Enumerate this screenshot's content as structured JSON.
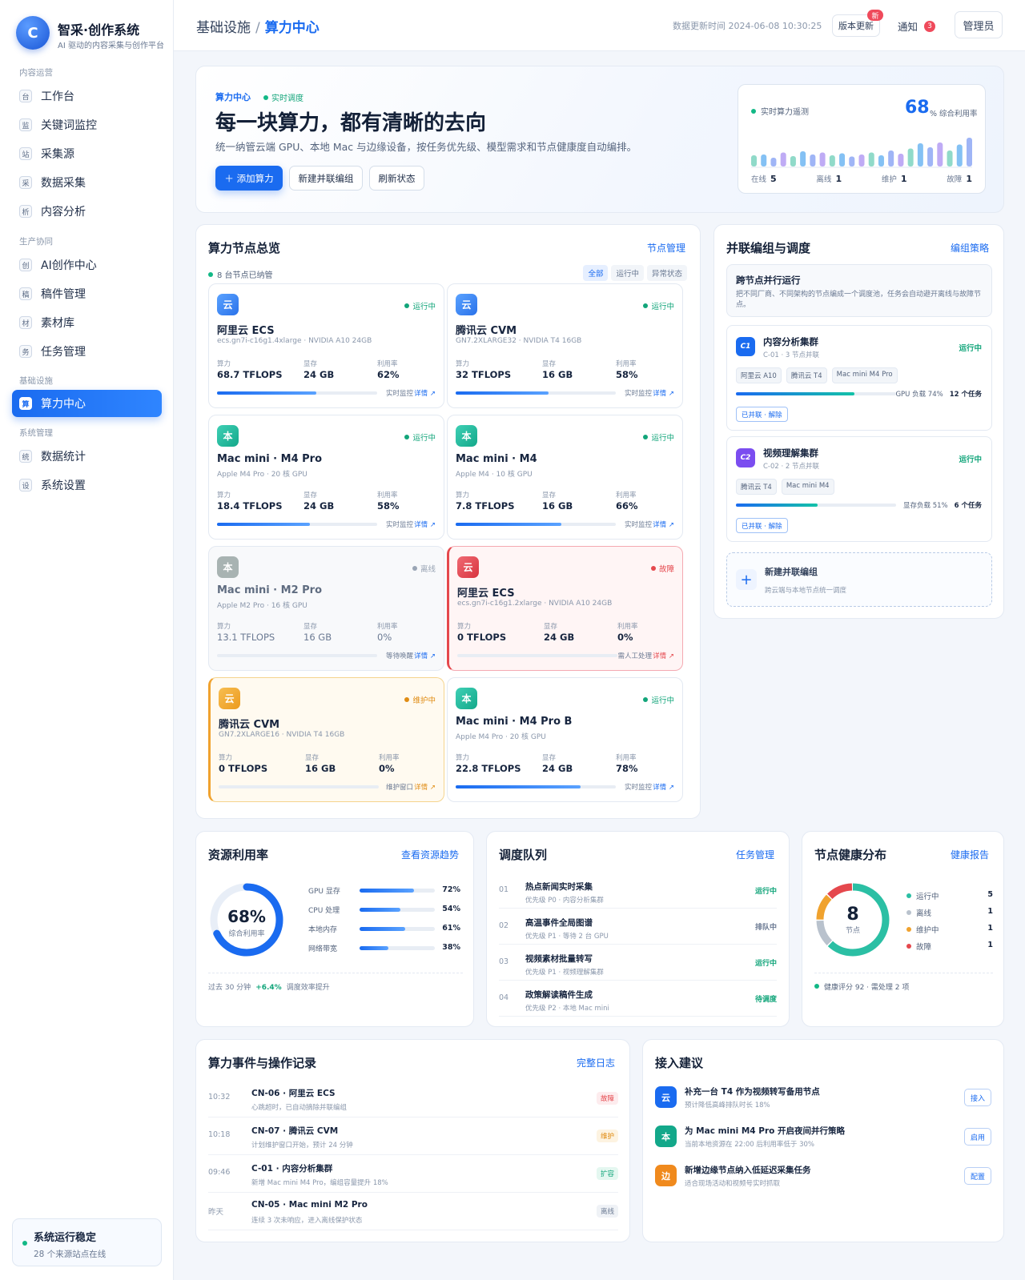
{
  "sidebar": {
    "logo_letter": "C",
    "brand_title": "智采·创作系统",
    "brand_sub": "AI 驱动的内容采集与创作平台",
    "groups": [
      "内容运营",
      "生产协同",
      "基础设施",
      "系统管理"
    ],
    "items": [
      {
        "icon": "台",
        "label": "工作台"
      },
      {
        "icon": "监",
        "label": "关键词监控"
      },
      {
        "icon": "站",
        "label": "采集源"
      },
      {
        "icon": "采",
        "label": "数据采集"
      },
      {
        "icon": "析",
        "label": "内容分析"
      },
      {
        "icon": "创",
        "label": "AI创作中心"
      },
      {
        "icon": "稿",
        "label": "稿件管理"
      },
      {
        "icon": "材",
        "label": "素材库"
      },
      {
        "icon": "务",
        "label": "任务管理"
      },
      {
        "icon": "算",
        "label": "算力中心"
      },
      {
        "icon": "统",
        "label": "数据统计"
      },
      {
        "icon": "设",
        "label": "系统设置"
      }
    ],
    "status_title": "系统运行稳定",
    "status_sub": "28 个来源站点在线"
  },
  "topbar": {
    "crumb_parent": "基础设施",
    "crumb_sep": "/",
    "crumb_current": "算力中心",
    "update_time": "数据更新时间 2024-06-08 10:30:25",
    "version_btn": "版本更新",
    "version_badge": "新",
    "notice": "通知",
    "notice_count": "3",
    "admin": "管理员"
  },
  "hero": {
    "tag": "算力中心",
    "live": "实时调度",
    "title": "每一块算力，都有清晰的去向",
    "desc": "统一纳管云端 GPU、本地 Mac 与边缘设备，按任务优先级、模型需求和节点健康度自动编排。",
    "btn_add": "＋ 添加算力",
    "btn_group": "新建并联编组",
    "btn_refresh": "刷新状态",
    "telemetry_label": "实时算力遥测",
    "telemetry_value": "68",
    "telemetry_unit": "% 综合利用率",
    "bars": [
      28,
      30,
      22,
      35,
      26,
      38,
      30,
      35,
      28,
      33,
      25,
      30,
      35,
      28,
      40,
      32,
      45,
      58,
      48,
      60,
      40,
      55,
      72
    ],
    "stats": [
      {
        "label": "在线",
        "value": "5"
      },
      {
        "label": "离线",
        "value": "1"
      },
      {
        "label": "维护",
        "value": "1"
      },
      {
        "label": "故障",
        "value": "1"
      }
    ]
  },
  "overview": {
    "title": "算力节点总览",
    "link": "节点管理",
    "sub": "8 台节点已纳管",
    "filters": [
      "全部",
      "运行中",
      "异常状态"
    ],
    "metric_labels": [
      "算力",
      "显存",
      "利用率"
    ],
    "detail": "详情 ↗",
    "nodes": [
      {
        "icon": "云",
        "kind": "cloud",
        "status": "运行中",
        "state": "run",
        "name": "阿里云 ECS",
        "spec": "ecs.gn7i-c16g1.4xlarge · NVIDIA A10 24GB",
        "power": "68.7 TFLOPS",
        "mem": "24 GB",
        "util": "62%",
        "bar": 62,
        "foot": "实时监控"
      },
      {
        "icon": "云",
        "kind": "cloud",
        "status": "运行中",
        "state": "run",
        "name": "腾讯云 CVM",
        "spec": "GN7.2XLARGE32 · NVIDIA T4 16GB",
        "power": "32 TFLOPS",
        "mem": "16 GB",
        "util": "58%",
        "bar": 58,
        "foot": "实时监控"
      },
      {
        "icon": "本",
        "kind": "local",
        "status": "运行中",
        "state": "run",
        "name": "Mac mini · M4 Pro",
        "spec": "Apple M4 Pro · 20 核 GPU",
        "power": "18.4 TFLOPS",
        "mem": "24 GB",
        "util": "58%",
        "bar": 58,
        "foot": "实时监控"
      },
      {
        "icon": "本",
        "kind": "local",
        "status": "运行中",
        "state": "run",
        "name": "Mac mini · M4",
        "spec": "Apple M4 · 10 核 GPU",
        "power": "7.8 TFLOPS",
        "mem": "16 GB",
        "util": "66%",
        "bar": 66,
        "foot": "实时监控"
      },
      {
        "icon": "本",
        "kind": "gray",
        "status": "离线",
        "state": "off",
        "name": "Mac mini · M2 Pro",
        "spec": "Apple M2 Pro · 16 核 GPU",
        "power": "13.1 TFLOPS",
        "mem": "16 GB",
        "util": "0%",
        "bar": 0,
        "foot": "等待唤醒"
      },
      {
        "icon": "云",
        "kind": "red",
        "status": "故障",
        "state": "fault",
        "name": "阿里云 ECS",
        "spec": "ecs.gn7i-c16g1.2xlarge · NVIDIA A10 24GB",
        "power": "0 TFLOPS",
        "mem": "24 GB",
        "util": "0%",
        "bar": 0,
        "foot": "需人工处理"
      },
      {
        "icon": "云",
        "kind": "orange",
        "status": "维护中",
        "state": "maint",
        "name": "腾讯云 CVM",
        "spec": "GN7.2XLARGE16 · NVIDIA T4 16GB",
        "power": "0 TFLOPS",
        "mem": "16 GB",
        "util": "0%",
        "bar": 0,
        "foot": "维护窗口"
      },
      {
        "icon": "本",
        "kind": "local",
        "status": "运行中",
        "state": "run",
        "name": "Mac mini · M4 Pro B",
        "spec": "Apple M4 Pro · 20 核 GPU",
        "power": "22.8 TFLOPS",
        "mem": "24 GB",
        "util": "78%",
        "bar": 78,
        "foot": "实时监控"
      }
    ]
  },
  "cluster": {
    "title": "并联编组与调度",
    "link": "编组策略",
    "intro_title": "跨节点并行运行",
    "intro_desc": "把不同厂商、不同架构的节点编成一个调度池，任务会自动避开离线与故障节点。",
    "groups": [
      {
        "code": "C1",
        "color": "#1a6bf0",
        "name": "内容分析集群",
        "sub": "C-01 · 3 节点并联",
        "status": "运行中",
        "tags": [
          "阿里云 A10",
          "腾讯云 T4",
          "Mac mini M4 Pro"
        ],
        "bar": 74,
        "load": "GPU 负载 74%",
        "tasks": "12 个任务",
        "btn": "已并联 · 解除"
      },
      {
        "code": "C2",
        "color": "#7b4df0",
        "name": "视频理解集群",
        "sub": "C-02 · 2 节点并联",
        "status": "运行中",
        "tags": [
          "腾讯云 T4",
          "Mac mini M4"
        ],
        "bar": 51,
        "load": "显存负载 51%",
        "tasks": "6 个任务",
        "btn": "已并联 · 解除"
      }
    ],
    "new_plus": "+",
    "new_title": "新建并联编组",
    "new_desc": "跨云端与本地节点统一调度"
  },
  "util": {
    "title": "资源利用率",
    "link": "查看资源趋势",
    "value": "68%",
    "value_num": 68,
    "label": "综合利用率",
    "rows": [
      {
        "label": "GPU 显存",
        "value": "72%",
        "pct": 72
      },
      {
        "label": "CPU 处理",
        "value": "54%",
        "pct": 54
      },
      {
        "label": "本地内存",
        "value": "61%",
        "pct": 61
      },
      {
        "label": "网络带宽",
        "value": "38%",
        "pct": 38
      }
    ],
    "foot_a": "过去 30 分钟",
    "foot_b": "+6.4%",
    "foot_c": "调度效率提升"
  },
  "queue": {
    "title": "调度队列",
    "link": "任务管理",
    "rows": [
      {
        "no": "01",
        "title": "热点新闻实时采集",
        "desc": "优先级 P0 · 内容分析集群",
        "status": "运行中",
        "color": "#12a57a"
      },
      {
        "no": "02",
        "title": "高温事件全局图谱",
        "desc": "优先级 P1 · 等待 2 台 GPU",
        "status": "排队中",
        "color": "#6b7a93"
      },
      {
        "no": "03",
        "title": "视频素材批量转写",
        "desc": "优先级 P1 · 视频理解集群",
        "status": "运行中",
        "color": "#12a57a"
      },
      {
        "no": "04",
        "title": "政策解读稿件生成",
        "desc": "优先级 P2 · 本地 Mac mini",
        "status": "待调度",
        "color": "#12a57a"
      }
    ]
  },
  "health": {
    "title": "节点健康分布",
    "link": "健康报告",
    "total": "8",
    "total_label": "节点",
    "rows": [
      {
        "label": "运行中",
        "value": "5",
        "count": 5,
        "color": "#2bbfa4"
      },
      {
        "label": "离线",
        "value": "1",
        "count": 1,
        "color": "#b9c2cd"
      },
      {
        "label": "维护中",
        "value": "1",
        "count": 1,
        "color": "#f0a22e"
      },
      {
        "label": "故障",
        "value": "1",
        "count": 1,
        "color": "#e5484d"
      }
    ],
    "foot": "健康评分 92 · 需处理 2 项"
  },
  "events": {
    "title": "算力事件与操作记录",
    "link": "完整日志",
    "rows": [
      {
        "time": "10:32",
        "title": "CN-06 · 阿里云 ECS",
        "desc": "心跳超时，已自动摘除并联编组",
        "tag": "故障",
        "fg": "#e5484d",
        "bg": "#fdecee"
      },
      {
        "time": "10:18",
        "title": "CN-07 · 腾讯云 CVM",
        "desc": "计划维护窗口开始，预计 24 分钟",
        "tag": "维护",
        "fg": "#e08c14",
        "bg": "#fdf3e1"
      },
      {
        "time": "09:46",
        "title": "C-01 · 内容分析集群",
        "desc": "新增 Mac mini M4 Pro，编组容量提升 18%",
        "tag": "扩容",
        "fg": "#12a57a",
        "bg": "#e4f7f0"
      },
      {
        "time": "昨天",
        "title": "CN-05 · Mac mini M2 Pro",
        "desc": "连续 3 次未响应，进入离线保护状态",
        "tag": "离线",
        "fg": "#6b7a93",
        "bg": "#eff2f6"
      }
    ]
  },
  "suggest": {
    "title": "接入建议",
    "rows": [
      {
        "icon": "云",
        "color": "#1a6bf0",
        "title": "补充一台 T4 作为视频转写备用节点",
        "desc": "预计降低高峰排队时长 18%",
        "btn": "接入"
      },
      {
        "icon": "本",
        "color": "#13a88a",
        "title": "为 Mac mini M4 Pro 开启夜间并行策略",
        "desc": "当前本地资源在 22:00 后利用率低于 30%",
        "btn": "启用"
      },
      {
        "icon": "边",
        "color": "#f08a1d",
        "title": "新增边缘节点纳入低延迟采集任务",
        "desc": "适合现场活动和视频号实时抓取",
        "btn": "配置"
      }
    ]
  }
}
